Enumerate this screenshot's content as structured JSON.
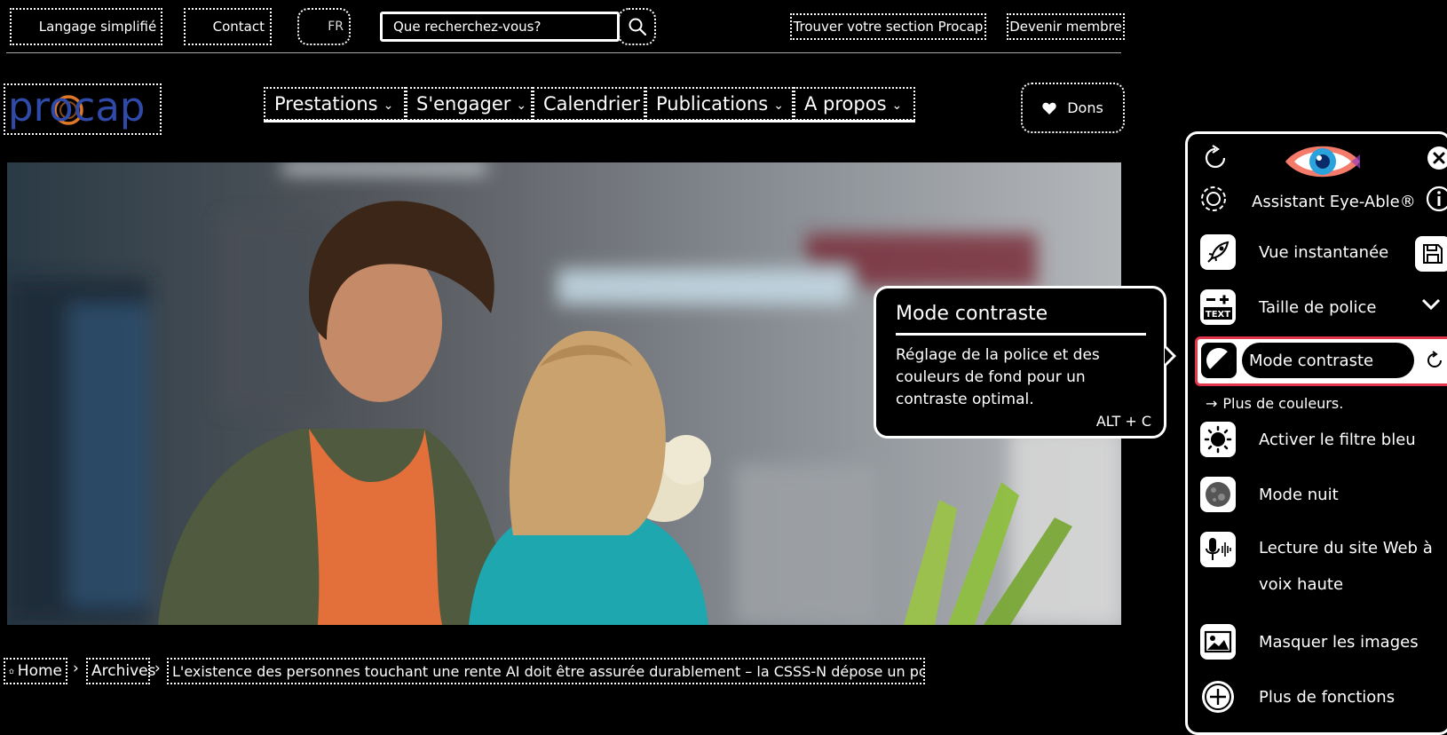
{
  "top_bar": {
    "simple_language": "Langage simplifié",
    "contact": "Contact",
    "language": "FR",
    "search_placeholder": "Que recherchez-vous?",
    "find_section": "Trouver votre section Procap",
    "become_member": "Devenir membre"
  },
  "brand": {
    "logo_text": "procap"
  },
  "nav": {
    "items": [
      "Prestations",
      "S'engager",
      "Calendrier",
      "Publications",
      "A propos"
    ],
    "donate": "Dons"
  },
  "breadcrumb": {
    "home": "Home",
    "archives": "Archives",
    "current": "L'existence des personnes touchant une rente AI doit être assurée durablement – la CSSS-N dépose un postulat",
    "separator": "›"
  },
  "tooltip": {
    "title": "Mode contraste",
    "body": "Réglage de la police et des couleurs de fond pour un contraste optimal.",
    "shortcut": "ALT + C"
  },
  "assistant": {
    "title": "Assistant Eye-Able®",
    "features": {
      "quick_view": "Vue instantanée",
      "font_size": "Taille de police",
      "contrast": "Mode contraste",
      "more_colors": "Plus de couleurs.",
      "blue_filter": "Activer le filtre bleu",
      "night_mode": "Mode nuit",
      "read_aloud": "Lecture du site Web à voix haute",
      "hide_images": "Masquer les images",
      "more_functions": "Plus de fonctions"
    }
  },
  "colors": {
    "background": "#000000",
    "logo_blue": "#2f4aa8",
    "logo_orange": "#e0782a",
    "highlight_red": "#e3364a"
  }
}
